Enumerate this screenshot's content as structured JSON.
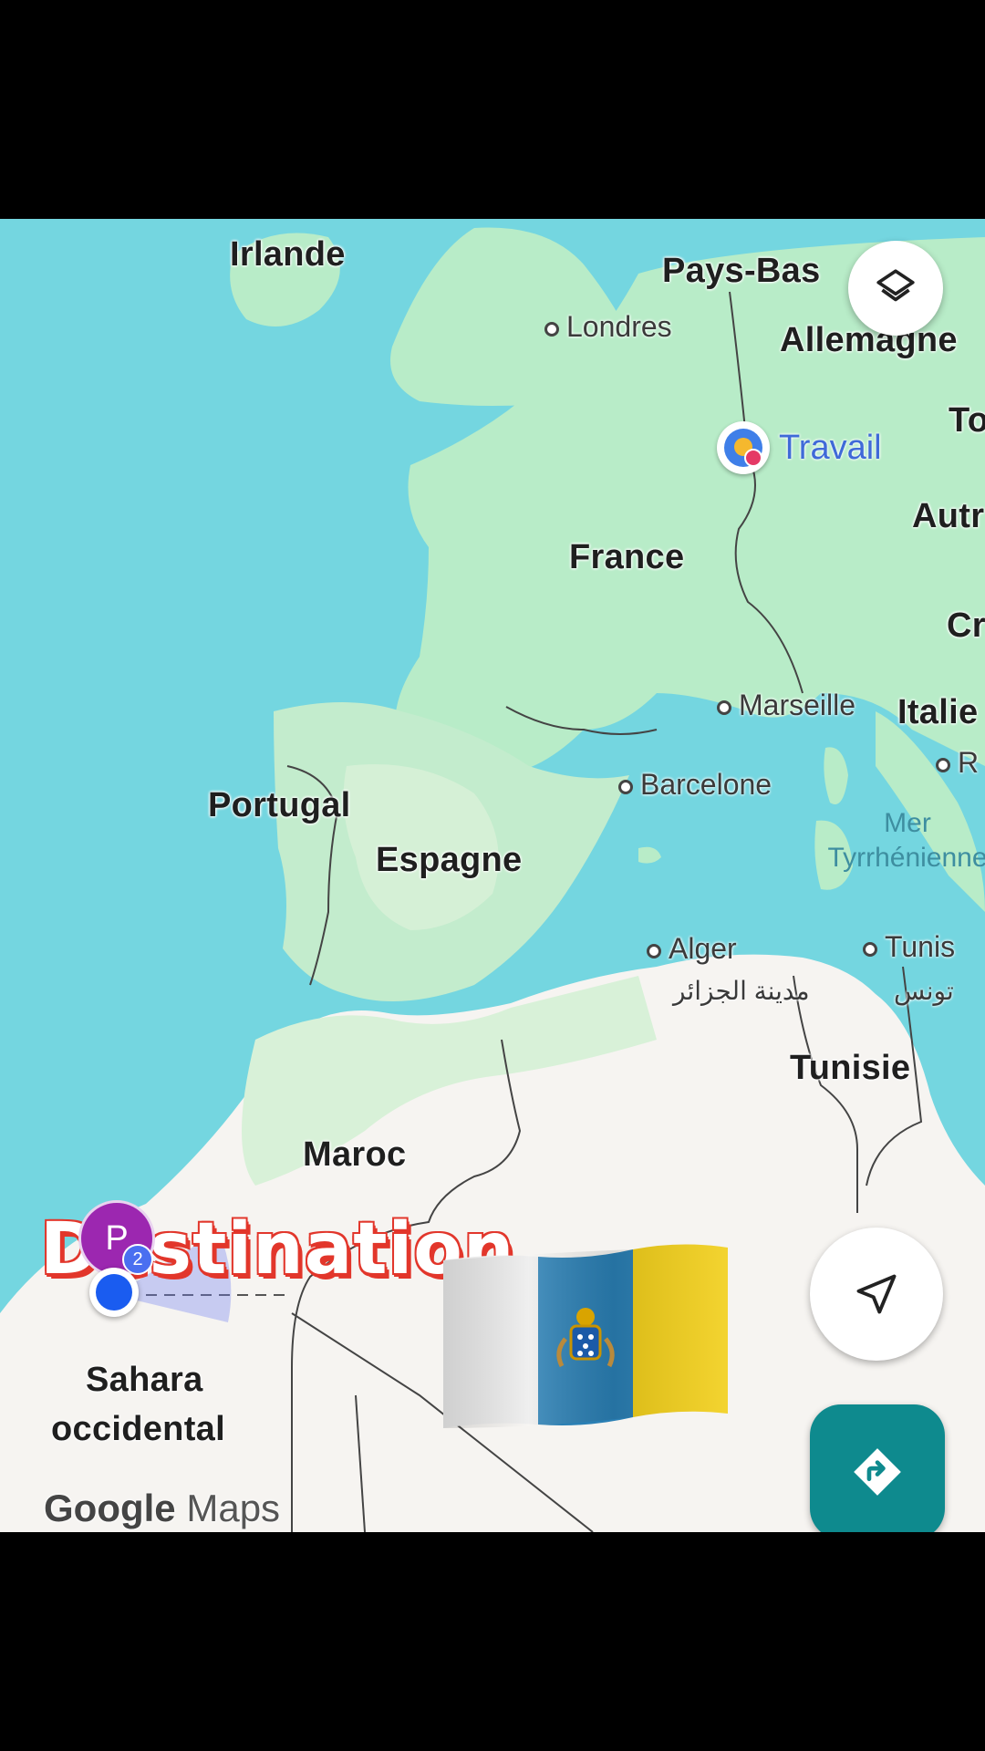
{
  "map": {
    "countries": {
      "irlande": "Irlande",
      "pays_bas": "Pays-Bas",
      "allemagne": "Allemagne",
      "france": "France",
      "italie": "Italie",
      "portugal": "Portugal",
      "espagne": "Espagne",
      "tunisie": "Tunisie",
      "maroc": "Maroc",
      "sahara_line1": "Sahara",
      "sahara_line2": "occidental",
      "autr": "Autr",
      "cr": "Cr",
      "to": "To"
    },
    "cities": {
      "londres": "Londres",
      "marseille": "Marseille",
      "barcelone": "Barcelone",
      "alger": "Alger",
      "alger_ar": "مدينة الجزائر",
      "tunis": "Tunis",
      "tunis_ar": "تونس",
      "r": "R"
    },
    "seas": {
      "tyrrhenian_line1": "Mer",
      "tyrrhenian_line2": "Tyrrhénienne"
    },
    "places": {
      "work": "Travail"
    },
    "markers": {
      "profile_letter": "P",
      "profile_badge": "2"
    },
    "attribution": {
      "brand": "Google",
      "product": "Maps"
    }
  },
  "overlay": {
    "caption": "Destination",
    "flag_name": "canary-islands-flag"
  },
  "colors": {
    "water": "#74d6e0",
    "land_green": "#b8ecc8",
    "land_desert": "#f6f4f1",
    "directions_button": "#0e8a8e",
    "location_blue": "#1a5cf0",
    "profile_purple": "#9c27b0"
  }
}
